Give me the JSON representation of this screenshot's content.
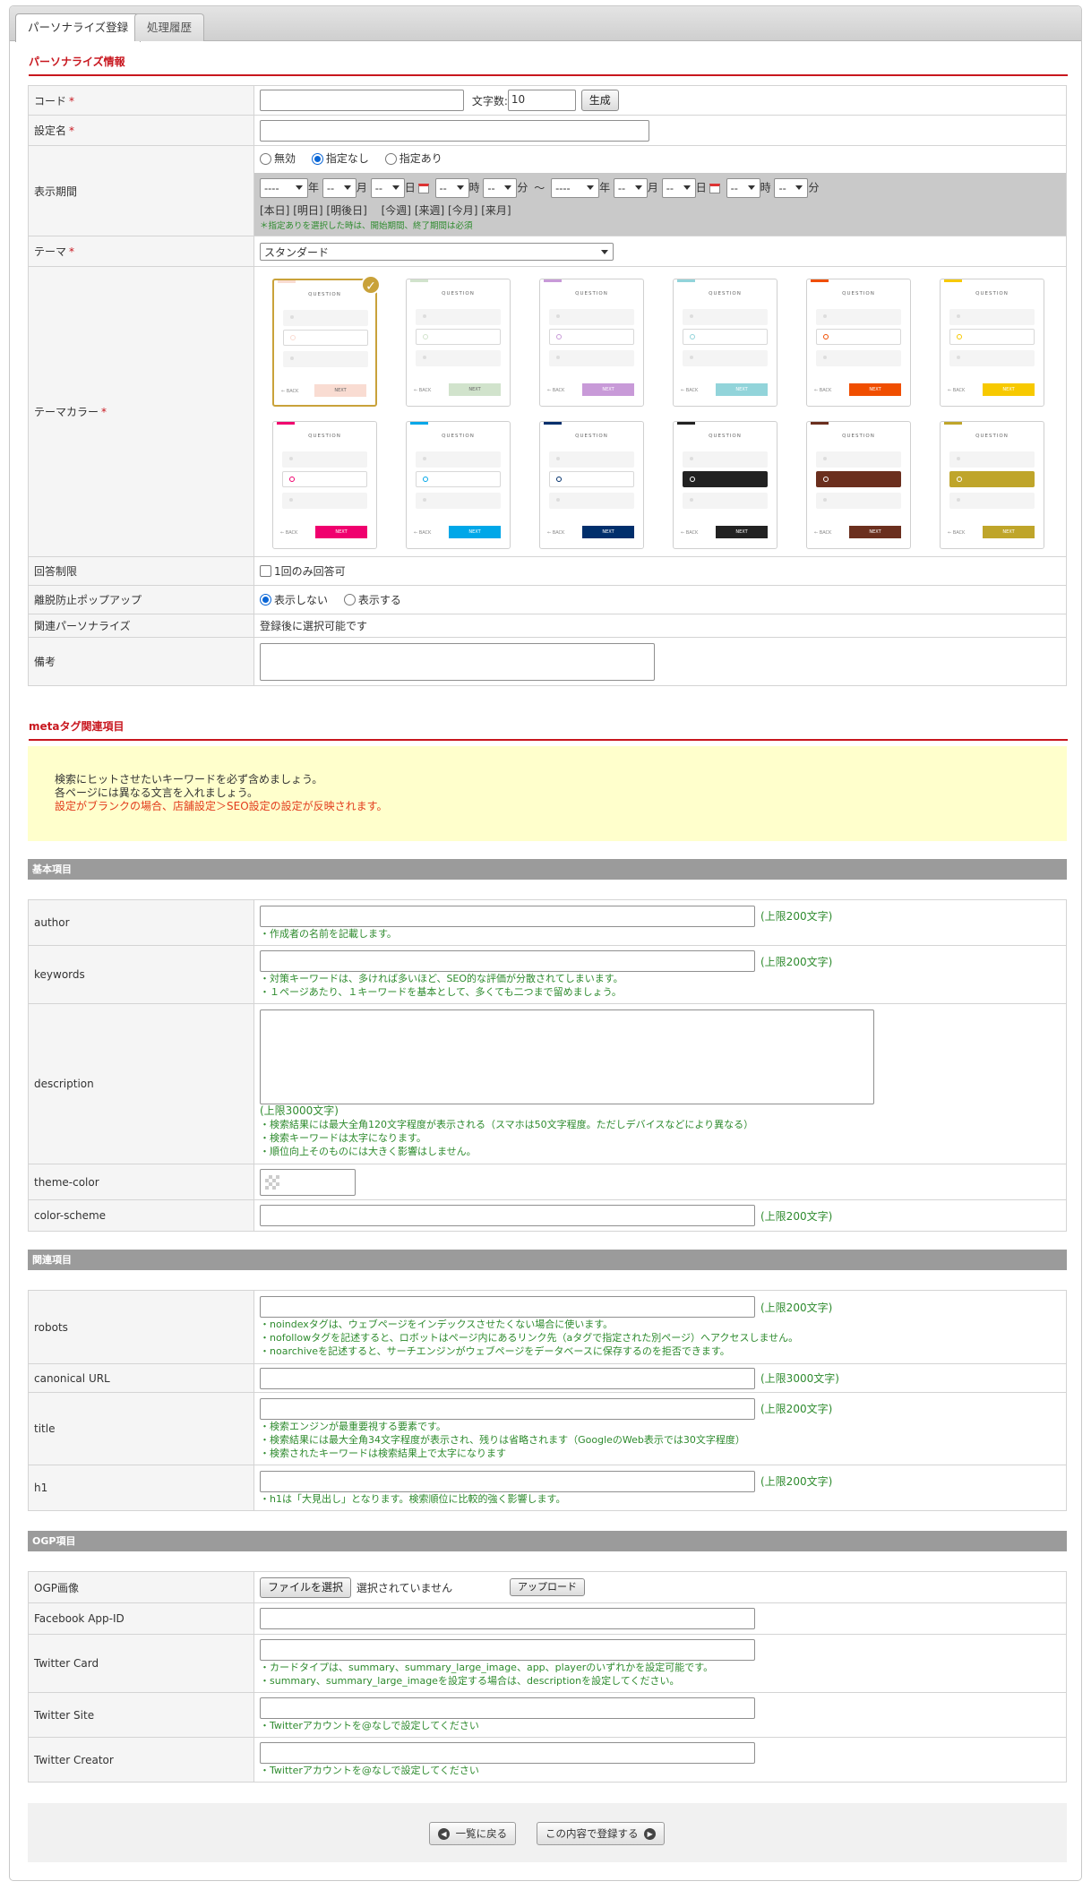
{
  "tabs": [
    {
      "label": "パーソナライズ登録",
      "active": true
    },
    {
      "label": "処理履歴",
      "active": false
    }
  ],
  "section1": {
    "title": "パーソナライズ情報",
    "required_mark": "*",
    "code": {
      "label": "コード",
      "char_count_label": "文字数:",
      "char_count_value": "10",
      "generate_button": "生成"
    },
    "setting_name": {
      "label": "設定名"
    },
    "display_period": {
      "label": "表示期間",
      "options": [
        "無効",
        "指定なし",
        "指定あり"
      ],
      "selected": "指定なし",
      "select_placeholder_year": "----",
      "select_placeholder": "--",
      "units": {
        "year": "年",
        "month": "月",
        "day": "日",
        "hour": "時",
        "minute": "分"
      },
      "range_sep": "〜",
      "quick_links": [
        "[本日]",
        "[明日]",
        "[明後日]",
        "[今週]",
        "[来週]",
        "[今月]",
        "[来月]"
      ],
      "note": "＊指定ありを選択した時は、開始期間、終了期間は必須"
    },
    "theme": {
      "label": "テーマ",
      "value": "スタンダード"
    },
    "theme_color": {
      "label": "テーマカラー",
      "question_text": "QUESTION",
      "back_text": "← BACK",
      "next_text": "NEXT",
      "selected_index": 0,
      "colors": [
        "#f9dcd2",
        "#d1e3cc",
        "#c89ad8",
        "#92d4da",
        "#f04e00",
        "#f7c900",
        "#f0006e",
        "#00a7e8",
        "#002f6c",
        "#222222",
        "#6b2f1e",
        "#bfa52a"
      ]
    },
    "answer_limit": {
      "label": "回答制限",
      "checkbox_label": "1回のみ回答可"
    },
    "exit_popup": {
      "label": "離脱防止ポップアップ",
      "options": [
        "表示しない",
        "表示する"
      ],
      "selected": "表示しない"
    },
    "related": {
      "label": "関連パーソナライズ",
      "value": "登録後に選択可能です"
    },
    "remarks": {
      "label": "備考"
    }
  },
  "section2": {
    "title": "metaタグ関連項目",
    "notice_lines": [
      "検索にヒットさせたいキーワードを必ず含めましょう。",
      "各ページには異なる文言を入れましょう。"
    ],
    "notice_warning": "設定がブランクの場合、店舗設定＞SEO設定の設定が反映されます。",
    "basic": {
      "title": "基本項目",
      "author": {
        "label": "author",
        "limit": "(上限200文字)",
        "notes": [
          "・作成者の名前を記載します。"
        ]
      },
      "keywords": {
        "label": "keywords",
        "limit": "(上限200文字)",
        "notes": [
          "・対策キーワードは、多ければ多いほど、SEO的な評価が分散されてしまいます。",
          "・１ページあたり、１キーワードを基本として、多くても二つまで留めましょう。"
        ]
      },
      "description": {
        "label": "description",
        "limit": "(上限3000文字)",
        "notes": [
          "・検索結果には最大全角120文字程度が表示される（スマホは50文字程度。ただしデバイスなどにより異なる）",
          "・検索キーワードは太字になります。",
          "・順位向上そのものには大きく影響はしません。"
        ]
      },
      "theme_color": {
        "label": "theme-color"
      },
      "color_scheme": {
        "label": "color-scheme",
        "limit": "(上限200文字)"
      }
    },
    "related": {
      "title": "関連項目",
      "robots": {
        "label": "robots",
        "limit": "(上限200文字)",
        "notes": [
          "・noindexタグは、ウェブページをインデックスさせたくない場合に使います。",
          "・nofollowタグを記述すると、ロボットはページ内にあるリンク先（aタグで指定された別ページ）へアクセスしません。",
          "・noarchiveを記述すると、サーチエンジンがウェブページをデータベースに保存するのを拒否できます。"
        ]
      },
      "canonical": {
        "label": "canonical URL",
        "limit": "(上限3000文字)"
      },
      "title_field": {
        "label": "title",
        "limit": "(上限200文字)",
        "notes": [
          "・検索エンジンが最重要視する要素です。",
          "・検索結果には最大全角34文字程度が表示され、残りは省略されます（GoogleのWeb表示では30文字程度）",
          "・検索されたキーワードは検索結果上で太字になります"
        ]
      },
      "h1": {
        "label": "h1",
        "limit": "(上限200文字)",
        "notes": [
          "・h1は「大見出し」となります。検索順位に比較的強く影響します。"
        ]
      }
    },
    "ogp": {
      "title": "OGP項目",
      "image": {
        "label": "OGP画像",
        "file_button": "ファイルを選択",
        "no_file": "選択されていません",
        "upload_button": "アップロード"
      },
      "fb_app": {
        "label": "Facebook App-ID"
      },
      "twitter_card": {
        "label": "Twitter Card",
        "notes": [
          "・カードタイプは、summary、summary_large_image、app、playerのいずれかを設定可能です。",
          "・summary、summary_large_imageを設定する場合は、descriptionを設定してください。"
        ]
      },
      "twitter_site": {
        "label": "Twitter Site",
        "notes": [
          "・Twitterアカウントを@なしで設定してください"
        ]
      },
      "twitter_creator": {
        "label": "Twitter Creator",
        "notes": [
          "・Twitterアカウントを@なしで設定してください"
        ]
      }
    }
  },
  "footer": {
    "back_button": "一覧に戻る",
    "submit_button": "この内容で登録する"
  }
}
